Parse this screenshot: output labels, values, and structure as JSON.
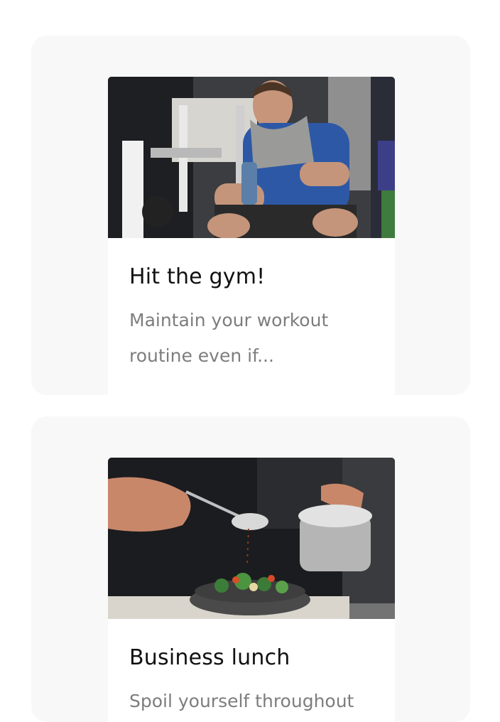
{
  "cards": [
    {
      "title": "Hit the gym!",
      "description": "Maintain your workout routine even if...",
      "image": "gym-photo"
    },
    {
      "title": "Business lunch",
      "description": "Spoil yourself throughout",
      "image": "chef-salad-photo"
    }
  ],
  "colors": {
    "page_background": "#ffffff",
    "card_background": "#f8f8f8",
    "inner_background": "#ffffff",
    "title": "#111111",
    "description": "#7d7d7d"
  }
}
